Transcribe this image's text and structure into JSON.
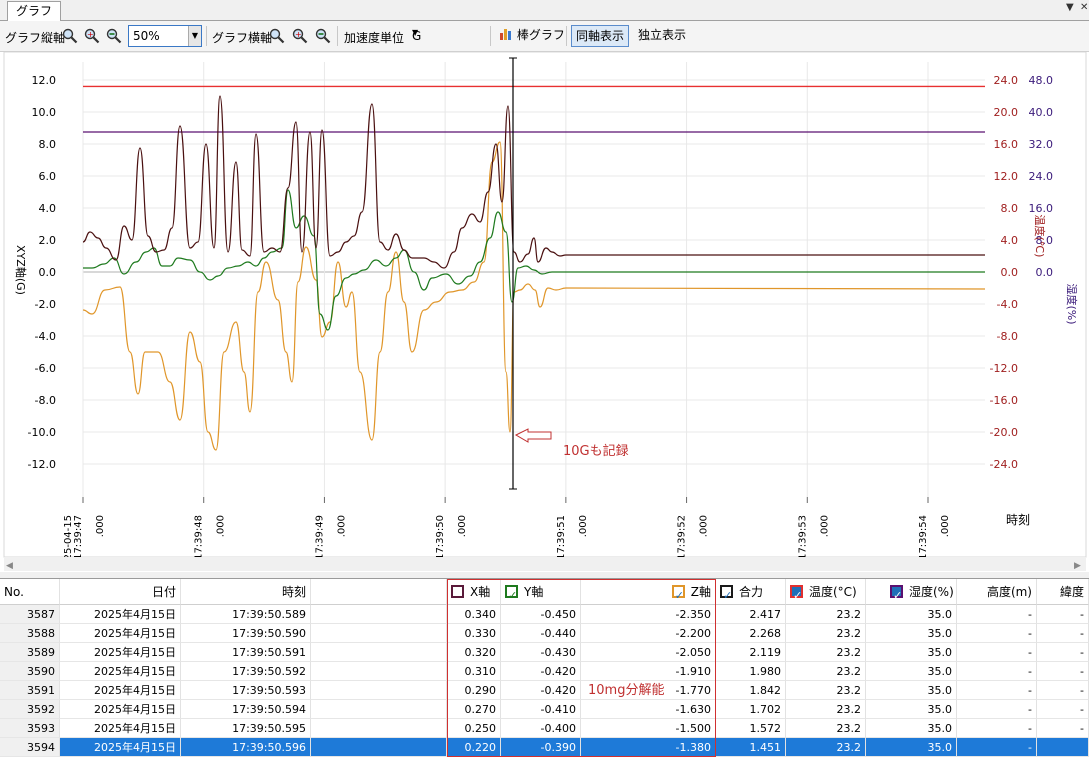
{
  "tab": {
    "title": "グラフ"
  },
  "toolbar": {
    "vert_label": "グラフ縦軸",
    "zoom_value": "50%",
    "horiz_label": "グラフ横軸",
    "accel_label": "加速度単位",
    "accel_value": "G",
    "bar_graph": "棒グラフ",
    "sync_axis": "同軸表示",
    "independent": "独立表示"
  },
  "chart_data": {
    "type": "line",
    "ylabel_left": "XYZ軸(G)",
    "ylabel_right1": "温度(℃)",
    "ylabel_right2": "湿度(%)",
    "xlabel": "時刻",
    "y_ticks": [
      "12.0",
      "10.0",
      "8.0",
      "6.0",
      "4.0",
      "2.0",
      "0.0",
      "-2.0",
      "-4.0",
      "-6.0",
      "-8.0",
      "-10.0",
      "-12.0"
    ],
    "temp_ticks": [
      "24.0",
      "20.0",
      "16.0",
      "12.0",
      "8.0",
      "4.0",
      "0.0",
      "-4.0",
      "-8.0",
      "-12.0",
      "-16.0",
      "-20.0",
      "-24.0"
    ],
    "hum_ticks": [
      "48.0",
      "40.0",
      "32.0",
      "24.0",
      "16.0",
      "8.0",
      "0.0"
    ],
    "x_ticks": [
      {
        "date": "25-04-15",
        "time": "17:39:47",
        "ms": ".000"
      },
      {
        "date": "",
        "time": "17:39:48",
        "ms": ".000"
      },
      {
        "date": "",
        "time": "17:39:49",
        "ms": ".000"
      },
      {
        "date": "",
        "time": "17:39:50",
        "ms": ".000"
      },
      {
        "date": "",
        "time": "17:39:51",
        "ms": ".000"
      },
      {
        "date": "",
        "time": "17:39:52",
        "ms": ".000"
      },
      {
        "date": "",
        "time": "17:39:53",
        "ms": ".000"
      },
      {
        "date": "",
        "time": "17:39:54",
        "ms": ".000"
      }
    ],
    "ylim": [
      -13,
      13
    ],
    "temperature_value": 23.2,
    "humidity_value": 35.0,
    "annotation": "10Gも記録",
    "series_colors": {
      "x": "#4a1010",
      "y": "#1e7a1e",
      "z": "#e0962a",
      "temp": "#e83030",
      "hum": "#5a1070"
    }
  },
  "table": {
    "annotation": "10mg分解能",
    "headers": [
      "No.",
      "日付",
      "時刻",
      "X軸",
      "Y軸",
      "Z軸",
      "合力",
      "温度(°C)",
      "湿度(%)",
      "高度(m)",
      "緯度"
    ],
    "rows": [
      [
        "3587",
        "2025年4月15日",
        "17:39:50.589",
        "0.340",
        "-0.450",
        "-2.350",
        "2.417",
        "23.2",
        "35.0",
        "-",
        "-"
      ],
      [
        "3588",
        "2025年4月15日",
        "17:39:50.590",
        "0.330",
        "-0.440",
        "-2.200",
        "2.268",
        "23.2",
        "35.0",
        "-",
        "-"
      ],
      [
        "3589",
        "2025年4月15日",
        "17:39:50.591",
        "0.320",
        "-0.430",
        "-2.050",
        "2.119",
        "23.2",
        "35.0",
        "-",
        "-"
      ],
      [
        "3590",
        "2025年4月15日",
        "17:39:50.592",
        "0.310",
        "-0.420",
        "-1.910",
        "1.980",
        "23.2",
        "35.0",
        "-",
        "-"
      ],
      [
        "3591",
        "2025年4月15日",
        "17:39:50.593",
        "0.290",
        "-0.420",
        "-1.770",
        "1.842",
        "23.2",
        "35.0",
        "-",
        "-"
      ],
      [
        "3592",
        "2025年4月15日",
        "17:39:50.594",
        "0.270",
        "-0.410",
        "-1.630",
        "1.702",
        "23.2",
        "35.0",
        "-",
        "-"
      ],
      [
        "3593",
        "2025年4月15日",
        "17:39:50.595",
        "0.250",
        "-0.400",
        "-1.500",
        "1.572",
        "23.2",
        "35.0",
        "-",
        "-"
      ],
      [
        "3594",
        "2025年4月15日",
        "17:39:50.596",
        "0.220",
        "-0.390",
        "-1.380",
        "1.451",
        "23.2",
        "35.0",
        "-",
        ""
      ]
    ]
  }
}
